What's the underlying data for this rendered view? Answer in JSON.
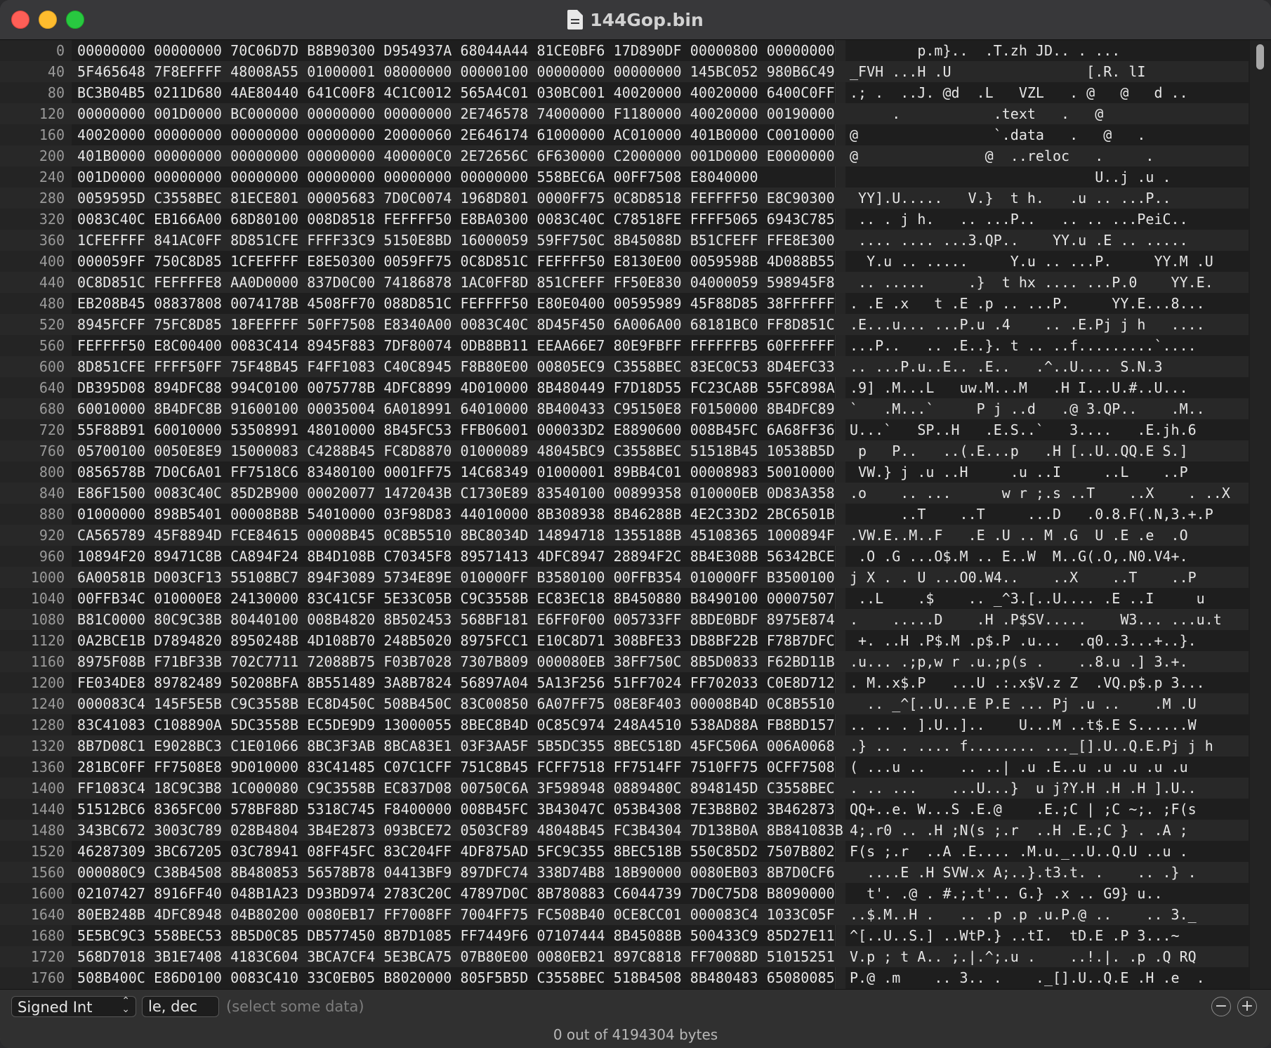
{
  "window": {
    "title": "144Gop.bin",
    "document_icon": "document-icon",
    "traffic_lights": [
      "close",
      "minimize",
      "zoom"
    ]
  },
  "rows": [
    {
      "offset": "0",
      "hex": "00000000 00000000 70C06D7D B8B90300 D954937A 68044A44 81CE0BF6 17D890DF 00000800 00000000",
      "ascii": "        p.m}..  .T.zh JD.. . ..."
    },
    {
      "offset": "40",
      "hex": "5F465648 7F8EFFFF 48008A55 01000001 08000000 00000100 00000000 00000000 145BC052 980B6C49",
      "ascii": "_FVH ...H .U                [.R. lI"
    },
    {
      "offset": "80",
      "hex": "BC3B04B5 0211D680 4AE80440 641C00F8 4C1C0012 565A4C01 030BC001 40020000 40020000 6400C0FF",
      "ascii": ".; .  ..J. @d  .L   VZL   . @   @   d .."
    },
    {
      "offset": "120",
      "hex": "00000000 001D0000 BC000000 00000000 00000000 2E746578 74000000 F1180000 40020000 00190000",
      "ascii": "     .           .text   .   @"
    },
    {
      "offset": "160",
      "hex": "40020000 00000000 00000000 00000000 20000060 2E646174 61000000 AC010000 401B0000 C0010000",
      "ascii": "@                `.data   .   @   ."
    },
    {
      "offset": "200",
      "hex": "401B0000 00000000 00000000 00000000 400000C0 2E72656C 6F630000 C2000000 001D0000 E0000000",
      "ascii": "@               @  ..reloc   .     ."
    },
    {
      "offset": "240",
      "hex": "001D0000 00000000 00000000 00000000 00000000 00000000 558BEC6A 00FF7508 E8040000",
      "ascii": "                             U..j .u ."
    },
    {
      "offset": "280",
      "hex": "0059595D C3558BEC 81ECE801 00005683 7D0C0074 1968D801 0000FF75 0C8D8518 FEFFFF50 E8C90300",
      "ascii": " YY].U.....   V.}  t h.   .u .. ...P.."
    },
    {
      "offset": "320",
      "hex": "0083C40C EB166A00 68D80100 008D8518 FEFFFF50 E8BA0300 0083C40C C78518FE FFFF5065 6943C785",
      "ascii": " .. . j h.   .. ...P..   .. .. ...PeiC.."
    },
    {
      "offset": "360",
      "hex": "1CFEFFFF 841AC0FF 8D851CFE FFFF33C9 5150E8BD 16000059 59FF750C 8B45088D B51CFEFF FFE8E300",
      "ascii": " .... .... ...3.QP..    YY.u .E .. ....."
    },
    {
      "offset": "400",
      "hex": "000059FF 750C8D85 1CFEFFFF E8E50300 0059FF75 0C8D851C FEFFFF50 E8130E00 0059598B 4D088B55",
      "ascii": "  Y.u .. .....     Y.u .. ...P.     YY.M .U"
    },
    {
      "offset": "440",
      "hex": "0C8D851C FEFFFFE8 AA0D0000 837D0C00 74186878 1AC0FF8D 851CFEFF FF50E830 04000059 598945F8",
      "ascii": " .. .....     .}  t hx .... ...P.0    YY.E."
    },
    {
      "offset": "480",
      "hex": "EB208B45 08837808 0074178B 4508FF70 088D851C FEFFFF50 E80E0400 00595989 45F88D85 38FFFFFF",
      "ascii": ". .E .x   t .E .p .. ...P.     YY.E...8..."
    },
    {
      "offset": "520",
      "hex": "8945FCFF 75FC8D85 18FEFFFF 50FF7508 E8340A00 0083C40C 8D45F450 6A006A00 68181BC0 FF8D851C",
      "ascii": ".E...u... ...P.u .4    .. .E.Pj j h   ...."
    },
    {
      "offset": "560",
      "hex": "FEFFFF50 E8C00400 0083C414 8945F883 7DF80074 0DB8BB11 EEAA66E7 80E9FBFF FFFFFFB5 60FFFFFF",
      "ascii": "...P..   .. .E..}. t .. ..f.........`...."
    },
    {
      "offset": "600",
      "hex": "8D851CFE FFFF50FF 75F48B45 F4FF1083 C40C8945 F8B80E00 00805EC9 C3558BEC 83EC0C53 8D4EFC33",
      "ascii": ".. ...P.u..E.. .E..   .^..U.... S.N.3"
    },
    {
      "offset": "640",
      "hex": "DB395D08 894DFC88 994C0100 0075778B 4DFC8899 4D010000 8B480449 F7D18D55 FC23CA8B 55FC898A",
      "ascii": ".9] .M...L   uw.M...M   .H I...U.#..U..."
    },
    {
      "offset": "680",
      "hex": "60010000 8B4DFC8B 91600100 00035004 6A018991 64010000 8B400433 C95150E8 F0150000 8B4DFC89",
      "ascii": "`   .M...`     P j ..d   .@ 3.QP..    .M.."
    },
    {
      "offset": "720",
      "hex": "55F88B91 60010000 53508991 48010000 8B45FC53 FFB06001 000033D2 E8890600 008B45FC 6A68FF36",
      "ascii": "U...`   SP..H   .E.S..`   3....   .E.jh.6"
    },
    {
      "offset": "760",
      "hex": "05700100 0050E8E9 15000083 C4288B45 FC8D8870 01000089 48045BC9 C3558BEC 51518B45 10538B5D",
      "ascii": " p   P..   ..(.E...p   .H [..U..QQ.E S.]"
    },
    {
      "offset": "800",
      "hex": "0856578B 7D0C6A01 FF7518C6 83480100 0001FF75 14C68349 01000001 89BB4C01 00008983 50010000",
      "ascii": " VW.} j .u ..H     .u ..I     ..L    ..P"
    },
    {
      "offset": "840",
      "hex": "E86F1500 0083C40C 85D2B900 00020077 1472043B C1730E89 83540100 00899358 010000EB 0D83A358",
      "ascii": ".o    .. ...      w r ;.s ..T    ..X    . ..X"
    },
    {
      "offset": "880",
      "hex": "01000000 898B5401 00008B8B 54010000 03F98D83 44010000 8B308938 8B46288B 4E2C33D2 2BC6501B",
      "ascii": "      ..T    ..T     ...D   .0.8.F(.N,3.+.P"
    },
    {
      "offset": "920",
      "hex": "CA565789 45F8894D FCE84615 00008B45 0C8B5510 8BC8034D 14894718 1355188B 45108365 1000894F",
      "ascii": ".VW.E..M..F   .E .U .. M .G  U .E .e  .O"
    },
    {
      "offset": "960",
      "hex": "10894F20 89471C8B CA894F24 8B4D108B C70345F8 89571413 4DFC8947 28894F2C 8B4E308B 56342BCE",
      "ascii": " .O .G ...O$.M .. E..W  M..G(.O,.N0.V4+."
    },
    {
      "offset": "1000",
      "hex": "6A00581B D003CF13 55108BC7 894F3089 5734E89E 010000FF B3580100 00FFB354 010000FF B3500100",
      "ascii": "j X . . U ...O0.W4..    ..X    ..T    ..P"
    },
    {
      "offset": "1040",
      "hex": "00FFB34C 010000E8 24130000 83C41C5F 5E33C05B C9C3558B EC83EC18 8B450880 B8490100 00007507",
      "ascii": " ..L    .$    .. _^3.[..U.... .E ..I     u"
    },
    {
      "offset": "1080",
      "hex": "B81C0000 80C9C38B 80440100 008B4820 8B502453 568BF181 E6FF0F00 005733FF 8BDE0BDF 8975E874",
      "ascii": ".    .....D    .H .P$SV.....    W3... ...u.t"
    },
    {
      "offset": "1120",
      "hex": "0A2BCE1B D7894820 8950248B 4D108B70 248B5020 8975FCC1 E10C8D71 308BFE33 DB8BF22B F78B7DFC",
      "ascii": " +. ..H .P$.M .p$.P .u...  .q0..3...+..}."
    },
    {
      "offset": "1160",
      "hex": "8975F08B F71BF33B 702C7711 72088B75 F03B7028 7307B809 000080EB 38FF750C 8B5D0833 F62BD11B",
      "ascii": ".u... .;p,w r .u.;p(s .    ..8.u .] 3.+."
    },
    {
      "offset": "1200",
      "hex": "FE034DE8 89782489 50208BFA 8B551489 3A8B7824 56897A04 5A13F256 51FF7024 FF702033 C0E8D712",
      "ascii": ". M..x$.P   ...U .:.x$V.z Z  .VQ.p$.p 3..."
    },
    {
      "offset": "1240",
      "hex": "000083C4 145F5E5B C9C3558B EC8D450C 508B450C 83C00850 6A07FF75 08E8F403 00008B4D 0C8B5510",
      "ascii": "  .. _^[..U...E P.E ... Pj .u ..    .M .U"
    },
    {
      "offset": "1280",
      "hex": "83C41083 C108890A 5DC3558B EC5DE9D9 13000055 8BEC8B4D 0C85C974 248A4510 538AD88A FB8BD157",
      "ascii": ".. .. . ].U..]..    U...M ..t$.E S......W"
    },
    {
      "offset": "1320",
      "hex": "8B7D08C1 E9028BC3 C1E01066 8BC3F3AB 8BCA83E1 03F3AA5F 5B5DC355 8BEC518D 45FC506A 006A0068",
      "ascii": ".} .. . .... f........ ..._[].U..Q.E.Pj j h"
    },
    {
      "offset": "1360",
      "hex": "281BC0FF FF7508E8 9D010000 83C41485 C07C1CFF 751C8B45 FCFF7518 FF7514FF 7510FF75 0CFF7508",
      "ascii": "( ...u ..    .. ..| .u .E..u .u .u .u .u"
    },
    {
      "offset": "1400",
      "hex": "FF1083C4 18C9C3B8 1C000080 C9C3558B EC837D08 00750C6A 3F598948 0889480C 8948145D C3558BEC",
      "ascii": ". .. ...    ...U...}  u j?Y.H .H .H ].U.."
    },
    {
      "offset": "1440",
      "hex": "51512BC6 8365FC00 578BF88D 5318C745 F8400000 008B45FC 3B43047C 053B4308 7E3B8B02 3B462873",
      "ascii": "QQ+..e. W...S .E.@    .E.;C | ;C ~;. ;F(s"
    },
    {
      "offset": "1480",
      "hex": "343BC672 3003C789 028B4804 3B4E2873 093BCE72 0503CF89 48048B45 FC3B4304 7D138B0A 8B841083B",
      "ascii": "4;.r0 .. .H ;N(s ;.r  ..H .E.;C } . .A ;"
    },
    {
      "offset": "1520",
      "hex": "46287309 3BC67205 03C78941 08FF45FC 83C204FF 4DF875AD 5FC9C355 8BEC518B 550C85D2 7507B802",
      "ascii": "F(s ;.r  ..A .E.... .M.u._..U..Q.U ..u ."
    },
    {
      "offset": "1560",
      "hex": "000080C9 C38B4508 8B480853 56578B78 04413BF9 897DFC74 338D74B8 18B90000 0080EB03 8B7D0CF6",
      "ascii": "  ....E .H SVW.x A;..}.t3.t. .    .. .} ."
    },
    {
      "offset": "1600",
      "hex": "02107427 8916FF40 048B1A23 D93BD974 2783C20C 47897D0C 8B780883 C6044739 7D0C75D8 B8090000",
      "ascii": "  t'. .@ . #.;.t'.. G.} .x .. G9} u.."
    },
    {
      "offset": "1640",
      "hex": "80EB248B 4DFC8948 04B80200 0080EB17 FF7008FF 7004FF75 FC508B40 0CE8CC01 000083C4 1033C05F",
      "ascii": "..$.M..H .   .. .p .p .u.P.@ ..    .. 3._"
    },
    {
      "offset": "1680",
      "hex": "5E5BC9C3 558BEC53 8B5D0C85 DB577450 8B7D1085 FF7449F6 07107444 8B45088B 500433C9 85D27E11",
      "ascii": "^[..U..S.] ..WtP.} ..tI.  tD.E .P 3...~"
    },
    {
      "offset": "1720",
      "hex": "568D7018 3B1E7408 4183C604 3BCA7CF4 5E3BCA75 07B80E00 0080EB21 897C8818 FF70088D 51015251",
      "ascii": "V.p ; t A.. ;.|.^;.u .    ..!.|. .p .Q RQ"
    },
    {
      "offset": "1760",
      "hex": "508B400C E86D0100 0083C410 33C0EB05 B8020000 805F5B5D C3558BEC 518B4508 8B480483 65080085",
      "ascii": "P.@ .m    .. 3.. .    ._[].U..Q.E .H .e  ."
    }
  ],
  "footer": {
    "type_select": "Signed Int",
    "endian_field": "le, dec",
    "value_placeholder": "(select some data)",
    "minus": "−",
    "plus": "+",
    "status": "0 out of 4194304 bytes"
  }
}
